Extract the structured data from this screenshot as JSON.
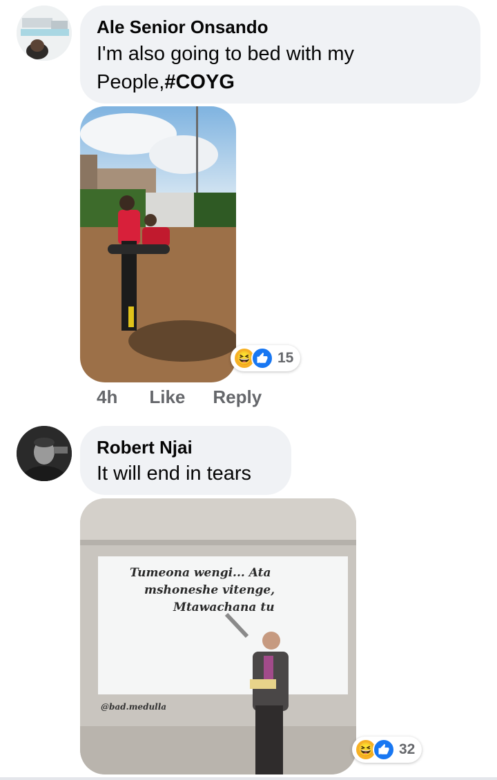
{
  "comments": [
    {
      "author": "Ale Senior Onsando",
      "text_line1": "I'm also going to bed with my",
      "text_line2_prefix": "People,",
      "hashtag": "#COYG",
      "reaction_count": "15",
      "time": "4h",
      "like_label": "Like",
      "reply_label": "Reply"
    },
    {
      "author": "Robert Njai",
      "text": "It will end in tears",
      "meme_line1": "Tumeona wengi... Ata",
      "meme_line2": "mshoneshe vitenge,",
      "meme_line3": "Mtawachana tu",
      "meme_watermark": "@bad.medulla",
      "reaction_count": "32"
    }
  ],
  "icons": {
    "haha": "laughing-face-icon",
    "like": "thumbs-up-icon"
  },
  "colors": {
    "bubble": "#f0f2f5",
    "like_blue": "#1877f2",
    "haha_yellow": "#f7b125",
    "meta_gray": "#65676b"
  }
}
